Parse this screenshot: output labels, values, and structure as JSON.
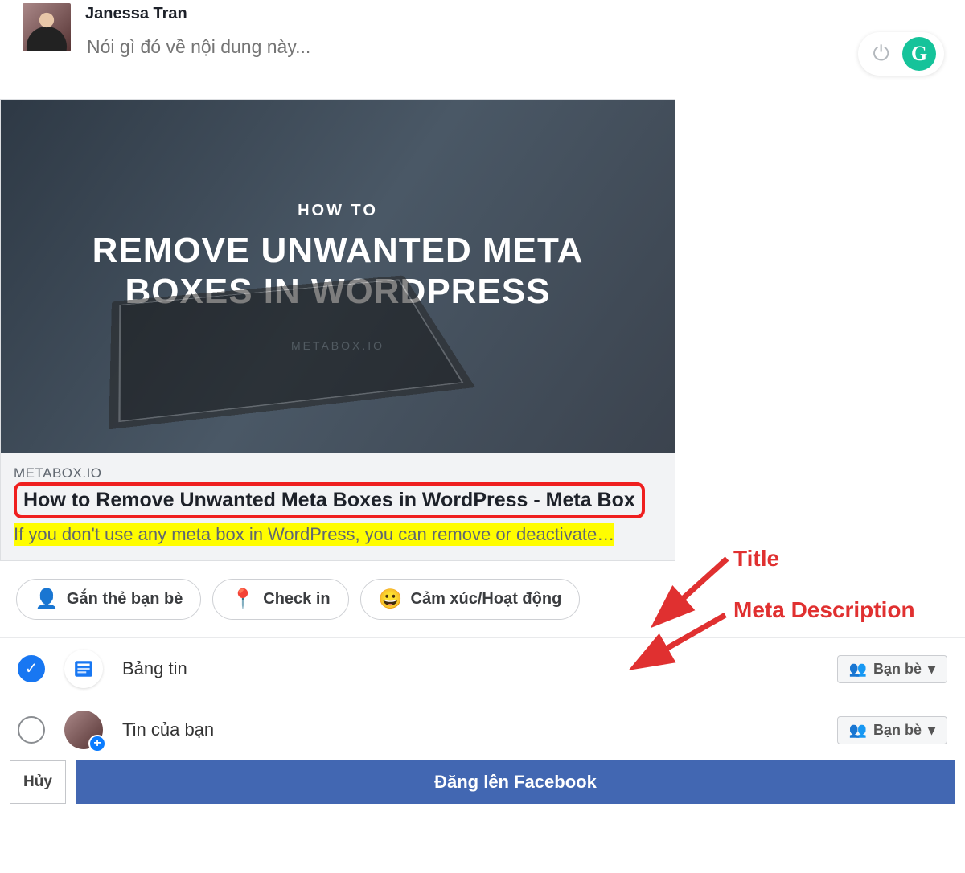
{
  "composer": {
    "user_name": "Janessa Tran",
    "placeholder": "Nói gì đó về nội dung này..."
  },
  "grammarly": {
    "power_icon": "power-icon",
    "badge_icon": "grammarly-icon",
    "badge_letter": "G"
  },
  "preview": {
    "hero": {
      "kicker": "HOW TO",
      "headline": "REMOVE UNWANTED META BOXES IN WORDPRESS",
      "site": "METABOX.IO"
    },
    "domain": "METABOX.IO",
    "title": "How to Remove Unwanted Meta Boxes in WordPress - Meta Box",
    "description": "If you don't use any meta box in WordPress, you can remove or deactivate…"
  },
  "annotations": {
    "title_label": "Title",
    "desc_label": "Meta Description"
  },
  "pills": [
    {
      "key": "tag",
      "label": "Gắn thẻ bạn bè",
      "icon": "👤"
    },
    {
      "key": "checkin",
      "label": "Check in",
      "icon": "📍"
    },
    {
      "key": "feeling",
      "label": "Cảm xúc/Hoạt động",
      "icon": "😀"
    }
  ],
  "audience": {
    "rows": [
      {
        "key": "feed",
        "label": "Bảng tin",
        "checked": true,
        "icon": "feed"
      },
      {
        "key": "story",
        "label": "Tin của bạn",
        "checked": false,
        "icon": "avatar"
      }
    ],
    "privacy_label": "Bạn bè",
    "privacy_icon": "friends-icon"
  },
  "footer": {
    "cancel": "Hủy",
    "post": "Đăng lên Facebook"
  }
}
